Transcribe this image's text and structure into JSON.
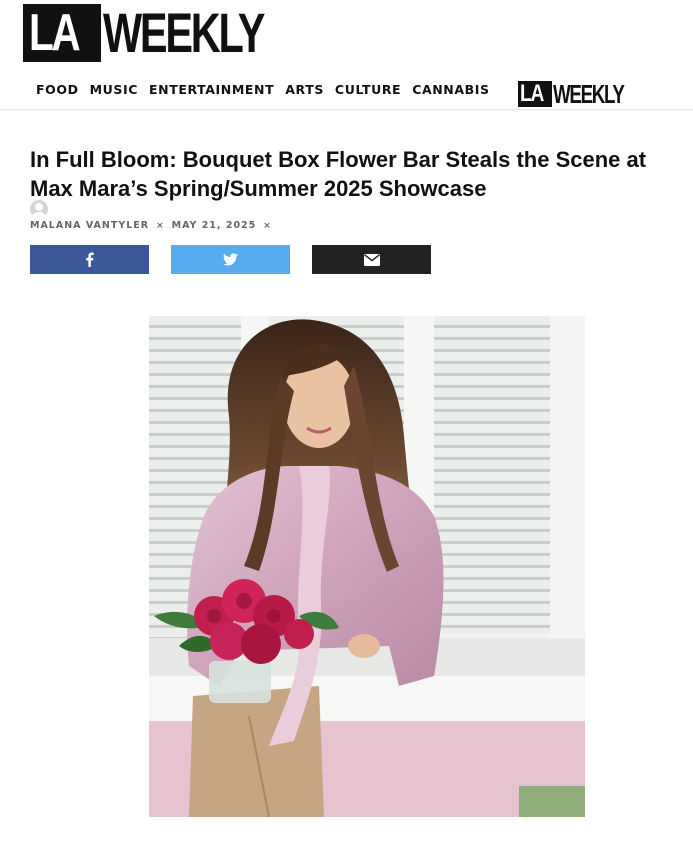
{
  "masthead": {
    "logo_la": "LA",
    "logo_weekly": "WEEKLY"
  },
  "nav": {
    "items": [
      "FOOD",
      "MUSIC",
      "ENTERTAINMENT",
      "ARTS",
      "CULTURE",
      "CANNABIS"
    ],
    "logo_la": "LA",
    "logo_weekly": "WEEKLY"
  },
  "article": {
    "title": "In Full Bloom: Bouquet Box Flower Bar Steals the Scene at Max Mara’s Spring/Summer 2025 Showcase",
    "author": "MALANA VANTYLER",
    "date": "MAY 21, 2025",
    "separator": "×"
  },
  "share": {
    "facebook_icon": "facebook-icon",
    "twitter_icon": "twitter-icon",
    "email_icon": "envelope-icon",
    "colors": {
      "facebook": "#3b5998",
      "twitter": "#55acee",
      "email": "#222222"
    }
  },
  "hero": {
    "description_icon": "photo"
  }
}
